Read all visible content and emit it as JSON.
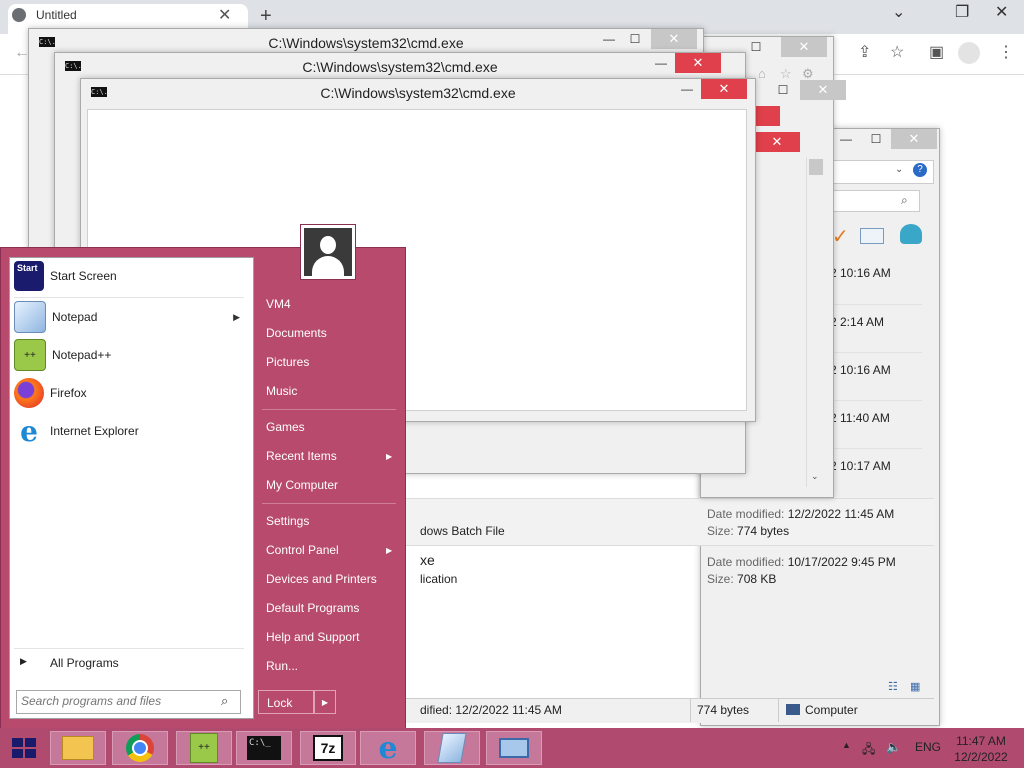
{
  "browser": {
    "tab_title": "Untitled",
    "tab_close": "✕",
    "new_tab": "+",
    "win_minimize": "⌄",
    "win_restore": "❐",
    "win_close": "✕",
    "toolbar_icons": [
      "share-icon",
      "star-icon",
      "sidepanel-icon",
      "profile-icon",
      "menu-icon"
    ]
  },
  "cmd_windows": [
    {
      "title": "C:\\Windows\\system32\\cmd.exe"
    },
    {
      "title": "C:\\Windows\\system32\\cmd.exe"
    },
    {
      "title": "C:\\Windows\\system32\\cmd.exe"
    }
  ],
  "cmd_icon_text": "C:\\.",
  "window_controls": {
    "minimize": "—",
    "maximize": "☐",
    "close": "✕"
  },
  "explorer": {
    "times": [
      "2 10:16 AM",
      "2 2:14 AM",
      "2 10:16 AM",
      "2 11:40 AM",
      "2 10:17 AM"
    ],
    "details": [
      {
        "type_fragment": "dows Batch File",
        "label1": "Date modified:",
        "value1": "12/2/2022 11:45 AM",
        "label2": "Size:",
        "value2": "774 bytes"
      },
      {
        "name_fragment": "xe",
        "type_fragment": "lication",
        "label1": "Date modified:",
        "value1": "10/17/2022 9:45 PM",
        "label2": "Size:",
        "value2": "708 KB"
      }
    ],
    "status": {
      "modified": "dified: 12/2/2022 11:45 AM",
      "size": "774 bytes",
      "location": "Computer"
    }
  },
  "start_menu": {
    "start_screen": {
      "label": "Start Screen",
      "icon_text": "Start"
    },
    "pinned": [
      {
        "label": "Notepad",
        "has_submenu": true
      },
      {
        "label": "Notepad++",
        "has_submenu": false
      },
      {
        "label": "Firefox",
        "has_submenu": false
      },
      {
        "label": "Internet Explorer",
        "has_submenu": false
      }
    ],
    "all_programs": "All Programs",
    "search_placeholder": "Search programs and files",
    "right_group1": [
      "VM4",
      "Documents",
      "Pictures",
      "Music"
    ],
    "right_group2": [
      "Games",
      "Recent Items",
      "My Computer"
    ],
    "right_group3": [
      "Settings",
      "Control Panel",
      "Devices and Printers",
      "Default Programs",
      "Help and Support",
      "Run..."
    ],
    "lock": "Lock"
  },
  "taskbar": {
    "apps": [
      "file-explorer",
      "chrome",
      "notepad-plus-plus",
      "cmd",
      "7zip",
      "internet-explorer",
      "notepad",
      "remote-desktop"
    ],
    "sevenzip_label": "7z",
    "cmd_label": "C:\\_",
    "language": "ENG",
    "time": "11:47 AM",
    "date": "12/2/2022"
  },
  "colors": {
    "start_bg": "#b84a6e",
    "taskbar_bg": "#b04b6f",
    "close_red": "#e0404b"
  }
}
